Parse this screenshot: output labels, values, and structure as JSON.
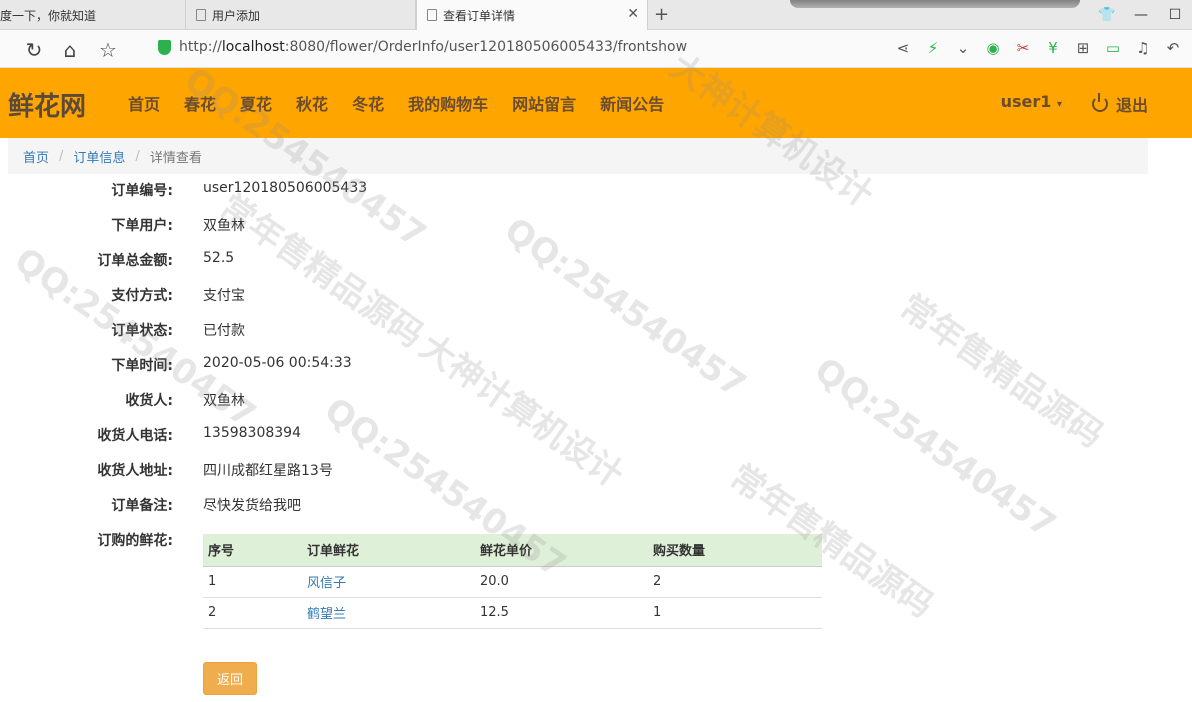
{
  "browser": {
    "tabs": [
      {
        "label": "度一下，你就知道"
      },
      {
        "label": "用户添加"
      },
      {
        "label": "查看订单详情"
      }
    ],
    "url_prefix": "http://",
    "url_host": "localhost",
    "url_rest": ":8080/flower/OrderInfo/user120180506005433/frontshow"
  },
  "site": {
    "brand": "鲜花网",
    "nav": [
      "首页",
      "春花",
      "夏花",
      "秋花",
      "冬花",
      "我的购物车",
      "网站留言",
      "新闻公告"
    ],
    "user": "user1",
    "logout": "退出"
  },
  "breadcrumb": {
    "home": "首页",
    "section": "订单信息",
    "current": "详情查看"
  },
  "order": {
    "fields": [
      {
        "label": "订单编号:",
        "value": "user120180506005433"
      },
      {
        "label": "下单用户:",
        "value": "双鱼林"
      },
      {
        "label": "订单总金额:",
        "value": "52.5"
      },
      {
        "label": "支付方式:",
        "value": "支付宝"
      },
      {
        "label": "订单状态:",
        "value": "已付款"
      },
      {
        "label": "下单时间:",
        "value": "2020-05-06 00:54:33"
      },
      {
        "label": "收货人:",
        "value": "双鱼林"
      },
      {
        "label": "收货人电话:",
        "value": "13598308394"
      },
      {
        "label": "收货人地址:",
        "value": "四川成都红星路13号"
      },
      {
        "label": "订单备注:",
        "value": "尽快发货给我吧"
      }
    ],
    "items_label": "订购的鲜花:",
    "items_headers": [
      "序号",
      "订单鲜花",
      "鲜花单价",
      "购买数量"
    ],
    "items": [
      {
        "no": "1",
        "flower": "风信子",
        "price": "20.0",
        "qty": "2"
      },
      {
        "no": "2",
        "flower": "鹤望兰",
        "price": "12.5",
        "qty": "1"
      }
    ],
    "back": "返回"
  },
  "watermarks": [
    "QQ:254540457",
    "大神计算机设计",
    "常年售精品源码"
  ]
}
